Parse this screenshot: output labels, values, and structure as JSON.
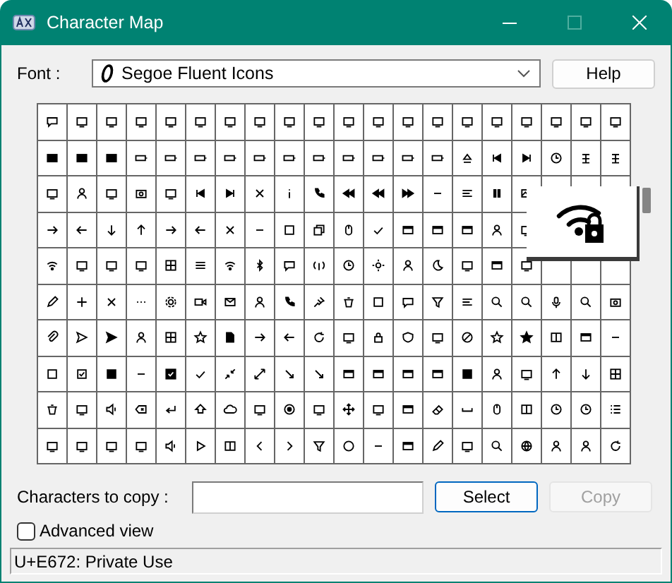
{
  "window": {
    "title": "Character Map"
  },
  "font": {
    "label": "Font :",
    "value": "Segoe Fluent Icons"
  },
  "help_button": {
    "label": "Help"
  },
  "character_grid": {
    "rows": [
      {
        "cells": [
          {
            "kind": "chat"
          },
          {
            "kind": "device"
          },
          {
            "kind": "device"
          },
          {
            "kind": "device"
          },
          {
            "kind": "device"
          },
          {
            "kind": "device"
          },
          {
            "kind": "device"
          },
          {
            "kind": "device"
          },
          {
            "kind": "device"
          },
          {
            "kind": "device"
          },
          {
            "kind": "device"
          },
          {
            "kind": "device"
          },
          {
            "kind": "device"
          },
          {
            "kind": "device"
          },
          {
            "kind": "device"
          },
          {
            "kind": "device"
          },
          {
            "kind": "device"
          },
          {
            "kind": "device"
          },
          {
            "kind": "device"
          },
          {
            "kind": "device"
          }
        ]
      },
      {
        "cells": [
          {
            "kind": "device-dark"
          },
          {
            "kind": "device-dark"
          },
          {
            "kind": "device-dark"
          },
          {
            "kind": "battery"
          },
          {
            "kind": "battery"
          },
          {
            "kind": "battery"
          },
          {
            "kind": "battery"
          },
          {
            "kind": "battery"
          },
          {
            "kind": "battery"
          },
          {
            "kind": "battery"
          },
          {
            "kind": "battery"
          },
          {
            "kind": "battery"
          },
          {
            "kind": "battery"
          },
          {
            "kind": "battery"
          },
          {
            "kind": "eject"
          },
          {
            "kind": "skip-back"
          },
          {
            "kind": "skip-next"
          },
          {
            "kind": "clock"
          },
          {
            "kind": "glyph"
          },
          {
            "kind": "glyph"
          }
        ]
      },
      {
        "cells": [
          {
            "kind": "device"
          },
          {
            "kind": "person"
          },
          {
            "kind": "device"
          },
          {
            "kind": "camera"
          },
          {
            "kind": "device"
          },
          {
            "kind": "skip-back"
          },
          {
            "kind": "skip-next"
          },
          {
            "kind": "close"
          },
          {
            "kind": "info"
          },
          {
            "kind": "phone"
          },
          {
            "kind": "rewind"
          },
          {
            "kind": "rewind"
          },
          {
            "kind": "forward"
          },
          {
            "kind": "minus"
          },
          {
            "kind": "align"
          },
          {
            "kind": "pause"
          },
          {
            "kind": "picture"
          },
          {
            "kind": "blank"
          },
          {
            "kind": "blank"
          },
          {
            "kind": "blank"
          }
        ]
      },
      {
        "cells": [
          {
            "kind": "arrow-right"
          },
          {
            "kind": "arrow-left"
          },
          {
            "kind": "arrow-down"
          },
          {
            "kind": "arrow-up"
          },
          {
            "kind": "arrow-right"
          },
          {
            "kind": "arrow-left"
          },
          {
            "kind": "close"
          },
          {
            "kind": "minus"
          },
          {
            "kind": "square"
          },
          {
            "kind": "copy"
          },
          {
            "kind": "mouse"
          },
          {
            "kind": "check"
          },
          {
            "kind": "window"
          },
          {
            "kind": "window"
          },
          {
            "kind": "window"
          },
          {
            "kind": "person"
          },
          {
            "kind": "device"
          }
        ]
      },
      {
        "cells": [
          {
            "kind": "wifi"
          },
          {
            "kind": "device"
          },
          {
            "kind": "device"
          },
          {
            "kind": "device"
          },
          {
            "kind": "grid"
          },
          {
            "kind": "menu"
          },
          {
            "kind": "wifi"
          },
          {
            "kind": "bluetooth"
          },
          {
            "kind": "chat"
          },
          {
            "kind": "signal"
          },
          {
            "kind": "clock"
          },
          {
            "kind": "sun"
          },
          {
            "kind": "person"
          },
          {
            "kind": "moon"
          },
          {
            "kind": "device"
          },
          {
            "kind": "window"
          },
          {
            "kind": "device"
          },
          {
            "kind": "blank"
          },
          {
            "kind": "blank"
          },
          {
            "kind": "blank"
          }
        ]
      },
      {
        "cells": [
          {
            "kind": "pencil"
          },
          {
            "kind": "plus"
          },
          {
            "kind": "close"
          },
          {
            "kind": "more"
          },
          {
            "kind": "gear"
          },
          {
            "kind": "video"
          },
          {
            "kind": "mail"
          },
          {
            "kind": "person"
          },
          {
            "kind": "phone"
          },
          {
            "kind": "pin"
          },
          {
            "kind": "trash"
          },
          {
            "kind": "square"
          },
          {
            "kind": "chat"
          },
          {
            "kind": "funnel"
          },
          {
            "kind": "align"
          },
          {
            "kind": "search"
          },
          {
            "kind": "search"
          },
          {
            "kind": "mic"
          },
          {
            "kind": "search"
          },
          {
            "kind": "camera"
          }
        ]
      },
      {
        "cells": [
          {
            "kind": "clip"
          },
          {
            "kind": "send"
          },
          {
            "kind": "send-filled"
          },
          {
            "kind": "person"
          },
          {
            "kind": "grid"
          },
          {
            "kind": "star"
          },
          {
            "kind": "file"
          },
          {
            "kind": "arrow-right"
          },
          {
            "kind": "arrow-left"
          },
          {
            "kind": "refresh"
          },
          {
            "kind": "device"
          },
          {
            "kind": "lock"
          },
          {
            "kind": "shield"
          },
          {
            "kind": "device"
          },
          {
            "kind": "circle-slash"
          },
          {
            "kind": "star"
          },
          {
            "kind": "star-filled"
          },
          {
            "kind": "columns"
          },
          {
            "kind": "window"
          },
          {
            "kind": "minus"
          }
        ]
      },
      {
        "cells": [
          {
            "kind": "square"
          },
          {
            "kind": "checkbox"
          },
          {
            "kind": "filled-square"
          },
          {
            "kind": "minus"
          },
          {
            "kind": "filled-check"
          },
          {
            "kind": "check"
          },
          {
            "kind": "collapse"
          },
          {
            "kind": "expand"
          },
          {
            "kind": "arrow-diag"
          },
          {
            "kind": "arrow-diag"
          },
          {
            "kind": "window"
          },
          {
            "kind": "window"
          },
          {
            "kind": "window"
          },
          {
            "kind": "window"
          },
          {
            "kind": "filled-square"
          },
          {
            "kind": "person"
          },
          {
            "kind": "device"
          },
          {
            "kind": "arrow-up"
          },
          {
            "kind": "arrow-down"
          },
          {
            "kind": "grid"
          }
        ]
      },
      {
        "cells": [
          {
            "kind": "trash"
          },
          {
            "kind": "device"
          },
          {
            "kind": "speaker"
          },
          {
            "kind": "backspace"
          },
          {
            "kind": "return"
          },
          {
            "kind": "upload"
          },
          {
            "kind": "cloud"
          },
          {
            "kind": "device"
          },
          {
            "kind": "at"
          },
          {
            "kind": "device"
          },
          {
            "kind": "move"
          },
          {
            "kind": "device"
          },
          {
            "kind": "window"
          },
          {
            "kind": "eraser"
          },
          {
            "kind": "space"
          },
          {
            "kind": "mouse"
          },
          {
            "kind": "columns"
          },
          {
            "kind": "clock"
          },
          {
            "kind": "clock"
          },
          {
            "kind": "list"
          }
        ]
      },
      {
        "cells": [
          {
            "kind": "device"
          },
          {
            "kind": "device"
          },
          {
            "kind": "device"
          },
          {
            "kind": "device"
          },
          {
            "kind": "speaker"
          },
          {
            "kind": "play"
          },
          {
            "kind": "columns"
          },
          {
            "kind": "chevron-left"
          },
          {
            "kind": "chevron-right"
          },
          {
            "kind": "funnel"
          },
          {
            "kind": "circle"
          },
          {
            "kind": "minus"
          },
          {
            "kind": "window"
          },
          {
            "kind": "pencil"
          },
          {
            "kind": "device"
          },
          {
            "kind": "search"
          },
          {
            "kind": "globe"
          },
          {
            "kind": "person"
          },
          {
            "kind": "person"
          },
          {
            "kind": "refresh"
          }
        ]
      }
    ]
  },
  "copy_field": {
    "label": "Characters to copy :"
  },
  "select_button": {
    "label": "Select"
  },
  "copy_button": {
    "label": "Copy",
    "disabled": true
  },
  "advanced_view": {
    "label": "Advanced view",
    "checked": false
  },
  "status_bar": "U+E672: Private Use"
}
